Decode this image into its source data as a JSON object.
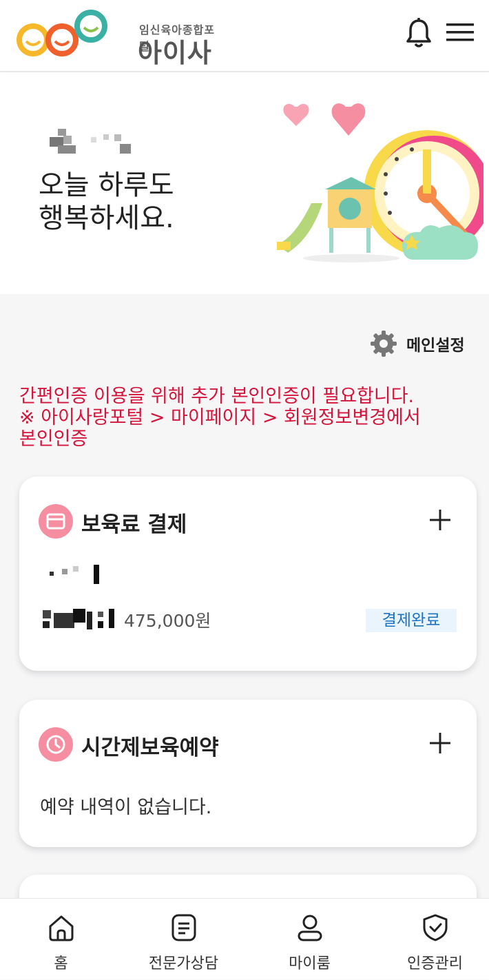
{
  "header": {
    "logo_sub": "임신육아종합포털",
    "logo_main": "아이사랑",
    "bell_icon": "bell-icon",
    "menu_icon": "hamburger-menu-icon"
  },
  "hero": {
    "greeting": "오늘 하루도\n행복하세요."
  },
  "settings": {
    "label": "메인설정",
    "icon": "gear-icon"
  },
  "notice": {
    "text": "간편인증 이용을 위해 추가 본인인증이 필요합니다.\n※ 아이사랑포털 > 마이페이지 > 회원정보변경에서\n본인인증",
    "color": "#d4143a"
  },
  "cards": {
    "payment": {
      "title": "보육료 결제",
      "icon": "card-icon",
      "amount": "475,000원",
      "status": "결제완료"
    },
    "reservation": {
      "title": "시간제보육예약",
      "icon": "clock-icon",
      "empty_text": "예약 내역이 없습니다."
    }
  },
  "tabbar": {
    "items": [
      {
        "label": "홈",
        "icon": "home-icon"
      },
      {
        "label": "전문가상담",
        "icon": "document-icon"
      },
      {
        "label": "마이룸",
        "icon": "person-icon"
      },
      {
        "label": "인증관리",
        "icon": "shield-icon"
      }
    ]
  },
  "colors": {
    "accent_pink": "#f48ea0",
    "badge_text": "#1c73c2",
    "badge_bg": "#eaf4fd"
  }
}
